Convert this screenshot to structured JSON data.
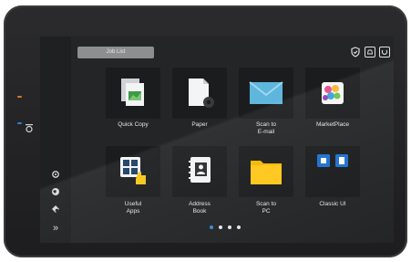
{
  "header": {
    "job_list_label": "Job List",
    "icons": [
      "shield-icon",
      "bell-icon",
      "power-icon"
    ]
  },
  "tiles": [
    {
      "label": "Quick Copy",
      "icon": "quick-copy-icon"
    },
    {
      "label": "Paper",
      "icon": "paper-settings-icon"
    },
    {
      "label": "Scan to\nE-mail",
      "icon": "envelope-icon"
    },
    {
      "label": "MarketPlace",
      "icon": "marketplace-icon"
    },
    {
      "label": "Useful\nApps",
      "icon": "useful-apps-icon"
    },
    {
      "label": "Address\nBook",
      "icon": "address-book-icon"
    },
    {
      "label": "Scan to\nPC",
      "icon": "folder-icon"
    },
    {
      "label": "Classic UI",
      "icon": "classic-ui-icon"
    }
  ],
  "sidebar": {
    "icons": [
      "settings-icon",
      "language-icon",
      "accessibility-icon",
      "expand-icon"
    ]
  },
  "pagination": {
    "page_count": 4,
    "current_page": 1
  },
  "colors": {
    "accent": "#2f8fe0",
    "led_orange": "#e0761c",
    "led_blue": "#2f7fd8",
    "folder_yellow": "#f5b800",
    "envelope_blue": "#5fb6dd"
  }
}
